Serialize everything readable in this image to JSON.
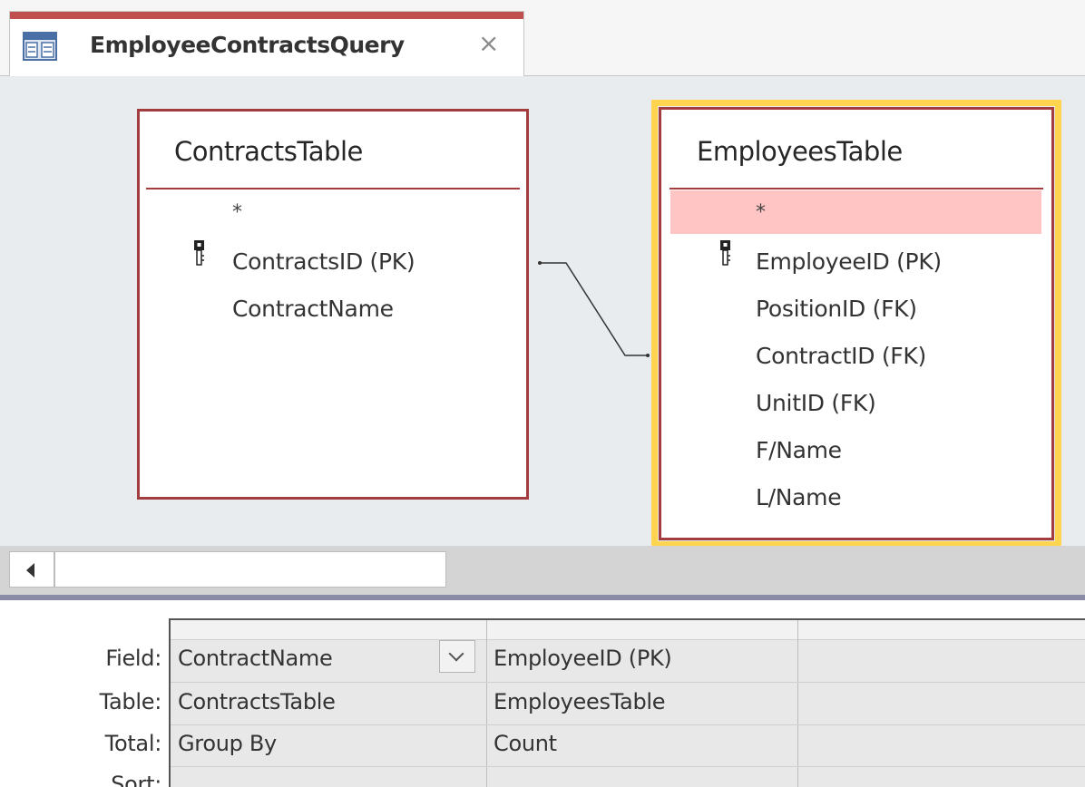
{
  "tab": {
    "title": "EmployeeContractsQuery",
    "close_glyph": "×",
    "accent_color": "#c0504d"
  },
  "tables": {
    "contracts": {
      "title": "ContractsTable",
      "fields": [
        {
          "name": "*",
          "is_key": false
        },
        {
          "name": "ContractsID (PK)",
          "is_key": true
        },
        {
          "name": "ContractName",
          "is_key": false
        }
      ]
    },
    "employees": {
      "title": "EmployeesTable",
      "selected": true,
      "fields": [
        {
          "name": "*",
          "is_key": false,
          "highlighted": true
        },
        {
          "name": "EmployeeID (PK)",
          "is_key": true
        },
        {
          "name": "PositionID (FK)",
          "is_key": false
        },
        {
          "name": "ContractID (FK)",
          "is_key": false
        },
        {
          "name": "UnitID (FK)",
          "is_key": false
        },
        {
          "name": "F/Name",
          "is_key": false
        },
        {
          "name": "L/Name",
          "is_key": false
        }
      ]
    }
  },
  "grid": {
    "row_labels": {
      "field": "Field:",
      "table": "Table:",
      "total": "Total:",
      "sort": "Sort:"
    },
    "columns": [
      {
        "field": "ContractName",
        "table": "ContractsTable",
        "total": "Group By",
        "sort": ""
      },
      {
        "field": "EmployeeID (PK)",
        "table": "EmployeesTable",
        "total": "Count",
        "sort": ""
      },
      {
        "field": "",
        "table": "",
        "total": "",
        "sort": ""
      }
    ]
  },
  "colors": {
    "table_border": "#a33d3d",
    "selection_ring": "#ffd54f",
    "highlight_row": "#ffc4c4",
    "design_background": "#e9ecef"
  }
}
